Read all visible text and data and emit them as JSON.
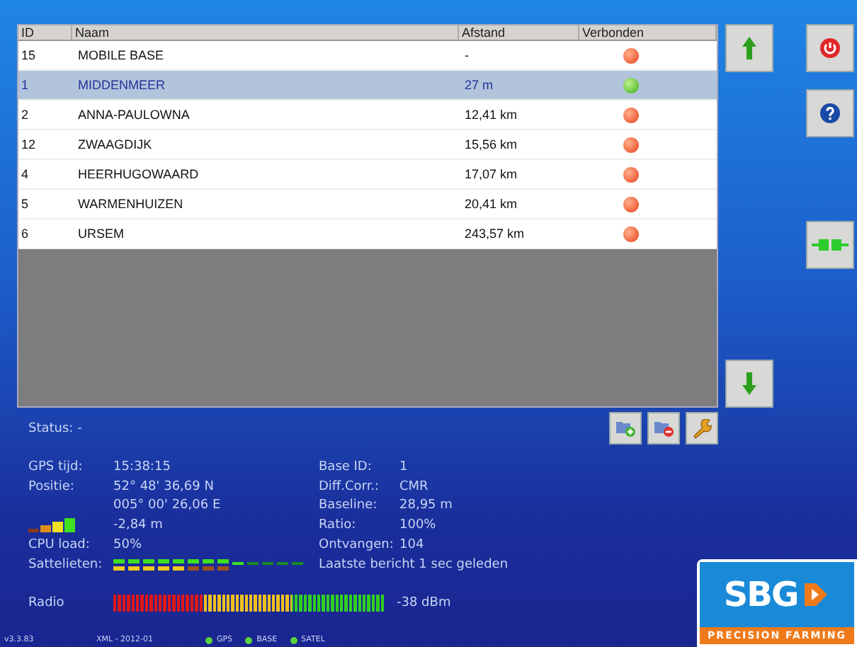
{
  "table": {
    "columns": [
      "ID",
      "Naam",
      "Afstand",
      "Verbonden"
    ],
    "rows": [
      {
        "id": "15",
        "name": "MOBILE BASE",
        "distance": "-",
        "connected": false,
        "selected": false
      },
      {
        "id": "1",
        "name": "MIDDENMEER",
        "distance": "27 m",
        "connected": true,
        "selected": true
      },
      {
        "id": "2",
        "name": "ANNA-PAULOWNA",
        "distance": "12,41 km",
        "connected": false,
        "selected": false
      },
      {
        "id": "12",
        "name": "ZWAAGDIJK",
        "distance": "15,56 km",
        "connected": false,
        "selected": false
      },
      {
        "id": "4",
        "name": "HEERHUGOWAARD",
        "distance": "17,07 km",
        "connected": false,
        "selected": false
      },
      {
        "id": "5",
        "name": "WARMENHUIZEN",
        "distance": "20,41 km",
        "connected": false,
        "selected": false
      },
      {
        "id": "6",
        "name": "URSEM",
        "distance": "243,57 km",
        "connected": false,
        "selected": false
      }
    ]
  },
  "status": {
    "label": "Status:",
    "value": "-"
  },
  "gps": [
    {
      "kind": "field",
      "label": "GPS tijd:",
      "value": "15:38:15"
    },
    {
      "kind": "field",
      "label": "Positie:",
      "value": "52° 48' 36,69 N"
    },
    {
      "kind": "continued",
      "value": "005° 00' 26,06 E"
    },
    {
      "kind": "signal",
      "value": "-2,84 m"
    },
    {
      "kind": "field",
      "label": "CPU load:",
      "value": "50%"
    },
    {
      "kind": "satellites",
      "label": "Sattelieten:"
    }
  ],
  "base": [
    {
      "kind": "field",
      "label": "Base ID:",
      "value": "1"
    },
    {
      "kind": "field",
      "label": "Diff.Corr.:",
      "value": "CMR"
    },
    {
      "kind": "field",
      "label": "Baseline:",
      "value": "28,95 m"
    },
    {
      "kind": "field",
      "label": "Ratio:",
      "value": "100%"
    },
    {
      "kind": "field",
      "label": "Ontvangen:",
      "value": "104"
    },
    {
      "kind": "note",
      "value": "Laatste bericht 1 sec geleden"
    }
  ],
  "radio": {
    "label": "Radio",
    "level": 1,
    "reading": "-38 dBm"
  },
  "footer": {
    "version": "v3.3.83",
    "xml": "XML - 2012-01",
    "indicators": [
      {
        "label": "GPS",
        "on": true
      },
      {
        "label": "BASE",
        "on": true
      },
      {
        "label": "SATEL",
        "on": true
      }
    ]
  },
  "logo": {
    "name": "SBG",
    "tagline": "PRECISION FARMING"
  }
}
